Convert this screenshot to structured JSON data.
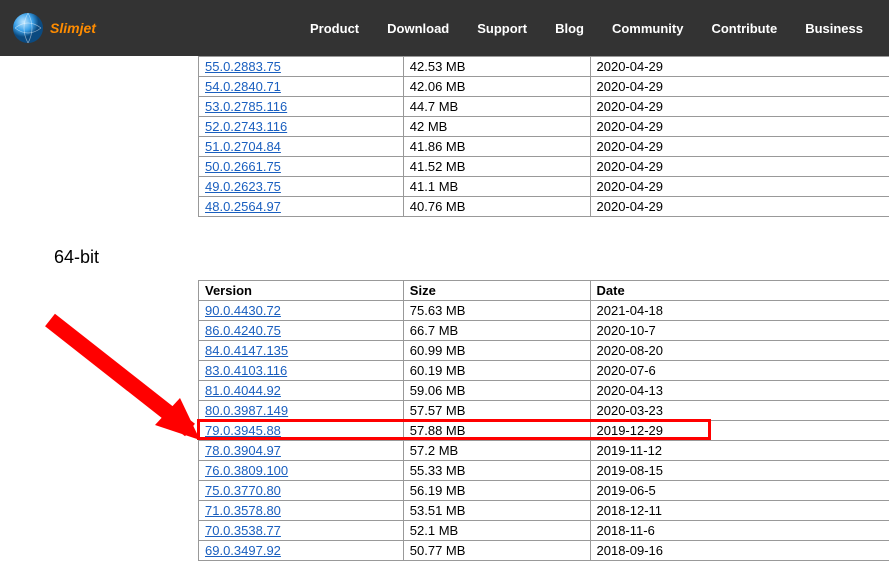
{
  "brand": "Slimjet",
  "nav": [
    "Product",
    "Download",
    "Support",
    "Blog",
    "Community",
    "Contribute",
    "Business"
  ],
  "table1": {
    "rows": [
      {
        "v": "55.0.2883.75",
        "s": "42.53 MB",
        "d": "2020-04-29"
      },
      {
        "v": "54.0.2840.71",
        "s": "42.06 MB",
        "d": "2020-04-29"
      },
      {
        "v": "53.0.2785.116",
        "s": "44.7 MB",
        "d": "2020-04-29"
      },
      {
        "v": "52.0.2743.116",
        "s": "42 MB",
        "d": "2020-04-29"
      },
      {
        "v": "51.0.2704.84",
        "s": "41.86 MB",
        "d": "2020-04-29"
      },
      {
        "v": "50.0.2661.75",
        "s": "41.52 MB",
        "d": "2020-04-29"
      },
      {
        "v": "49.0.2623.75",
        "s": "41.1 MB",
        "d": "2020-04-29"
      },
      {
        "v": "48.0.2564.97",
        "s": "40.76 MB",
        "d": "2020-04-29"
      }
    ]
  },
  "section2_title": "64-bit",
  "table2": {
    "headers": {
      "v": "Version",
      "s": "Size",
      "d": "Date"
    },
    "rows": [
      {
        "v": "90.0.4430.72",
        "s": "75.63 MB",
        "d": "2021-04-18"
      },
      {
        "v": "86.0.4240.75",
        "s": "66.7 MB",
        "d": "2020-10-7"
      },
      {
        "v": "84.0.4147.135",
        "s": "60.99 MB",
        "d": "2020-08-20"
      },
      {
        "v": "83.0.4103.116",
        "s": "60.19 MB",
        "d": "2020-07-6"
      },
      {
        "v": "81.0.4044.92",
        "s": "59.06 MB",
        "d": "2020-04-13"
      },
      {
        "v": "80.0.3987.149",
        "s": "57.57 MB",
        "d": "2020-03-23"
      },
      {
        "v": "79.0.3945.88",
        "s": "57.88 MB",
        "d": "2019-12-29",
        "hl": true
      },
      {
        "v": "78.0.3904.97",
        "s": "57.2 MB",
        "d": "2019-11-12"
      },
      {
        "v": "76.0.3809.100",
        "s": "55.33 MB",
        "d": "2019-08-15"
      },
      {
        "v": "75.0.3770.80",
        "s": "56.19 MB",
        "d": "2019-06-5"
      },
      {
        "v": "71.0.3578.80",
        "s": "53.51 MB",
        "d": "2018-12-11"
      },
      {
        "v": "70.0.3538.77",
        "s": "52.1 MB",
        "d": "2018-11-6"
      },
      {
        "v": "69.0.3497.92",
        "s": "50.77 MB",
        "d": "2018-09-16"
      }
    ]
  }
}
